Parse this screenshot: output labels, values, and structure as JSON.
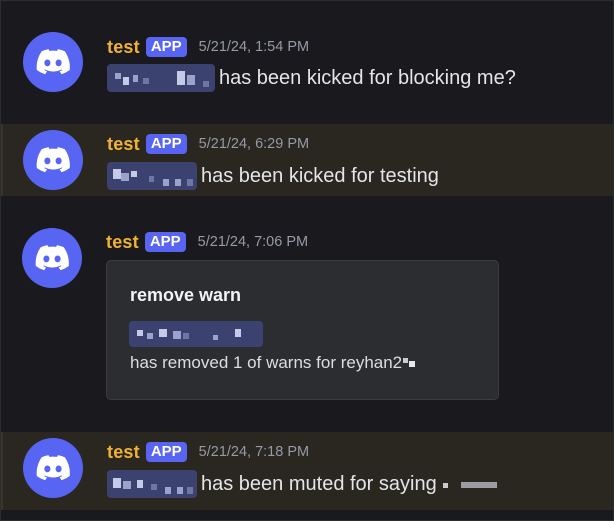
{
  "messages": [
    {
      "username": "test",
      "badge": "APP",
      "timestamp": "5/21/24, 1:54 PM",
      "text": "has been kicked for blocking me?"
    },
    {
      "username": "test",
      "badge": "APP",
      "timestamp": "5/21/24, 6:29 PM",
      "text": "has been kicked for testing"
    },
    {
      "username": "test",
      "badge": "APP",
      "timestamp": "5/21/24, 7:06 PM",
      "embed": {
        "title": "remove warn",
        "description": "has removed 1 of warns for reyhan2"
      }
    },
    {
      "username": "test",
      "badge": "APP",
      "timestamp": "5/21/24, 7:18 PM",
      "text": "has been muted for saying"
    }
  ],
  "colors": {
    "background": "#1a1a1e",
    "highlight": "#2a2620",
    "username": "#f0b232",
    "badge": "#5865f2",
    "avatar": "#5865f2",
    "mention": "#3c4270"
  },
  "icons": {
    "avatar": "discord-logo-icon"
  }
}
